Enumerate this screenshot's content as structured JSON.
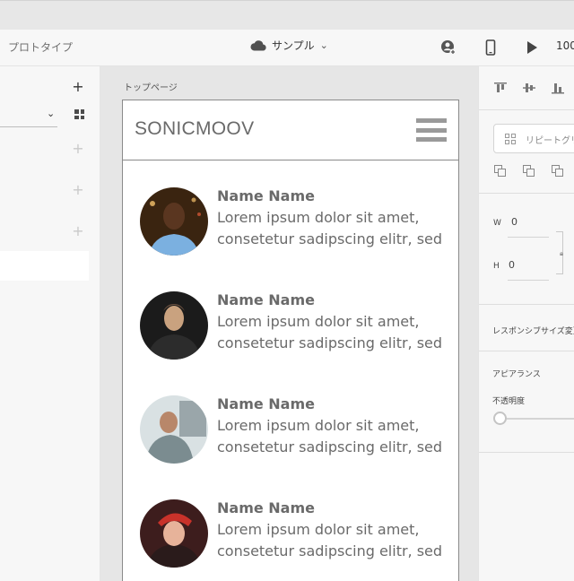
{
  "toolbar": {
    "mode_label": "プロトタイプ",
    "document_title": "サンプル",
    "zoom": "100"
  },
  "canvas": {
    "artboard_label": "トップページ",
    "app": {
      "brand": "SONICMOOV",
      "items": [
        {
          "name": "Name Name",
          "text": "Lorem ipsum dolor sit amet, consetetur sadipscing elitr, sed",
          "avatar_colors": [
            "#3a2410",
            "#d49a55",
            "#7bb0e0"
          ]
        },
        {
          "name": "Name Name",
          "text": "Lorem ipsum dolor sit amet, consetetur sadipscing elitr, sed",
          "avatar_colors": [
            "#1b1b1b",
            "#c9a27f",
            "#2c2c2c"
          ]
        },
        {
          "name": "Name Name",
          "text": "Lorem ipsum dolor sit amet, consetetur sadipscing elitr, sed",
          "avatar_colors": [
            "#d9e1e3",
            "#b8876a",
            "#7b8c90"
          ]
        },
        {
          "name": "Name Name",
          "text": "Lorem ipsum dolor sit amet, consetetur sadipscing elitr, sed",
          "avatar_colors": [
            "#3d1d1d",
            "#c8322a",
            "#e7b39a"
          ]
        }
      ]
    }
  },
  "properties": {
    "repeat_grid_label": "リピートグリッド",
    "width_label": "W",
    "width_value": "0",
    "height_label": "H",
    "height_value": "0",
    "responsive_label": "レスポンシブサイズ変更",
    "appearance_label": "アピアランス",
    "opacity_label": "不透明度"
  },
  "colors": {
    "text_gray": "#6a6a6a",
    "panel_bg": "#f7f7f7",
    "canvas_bg": "#e6e6e6"
  }
}
